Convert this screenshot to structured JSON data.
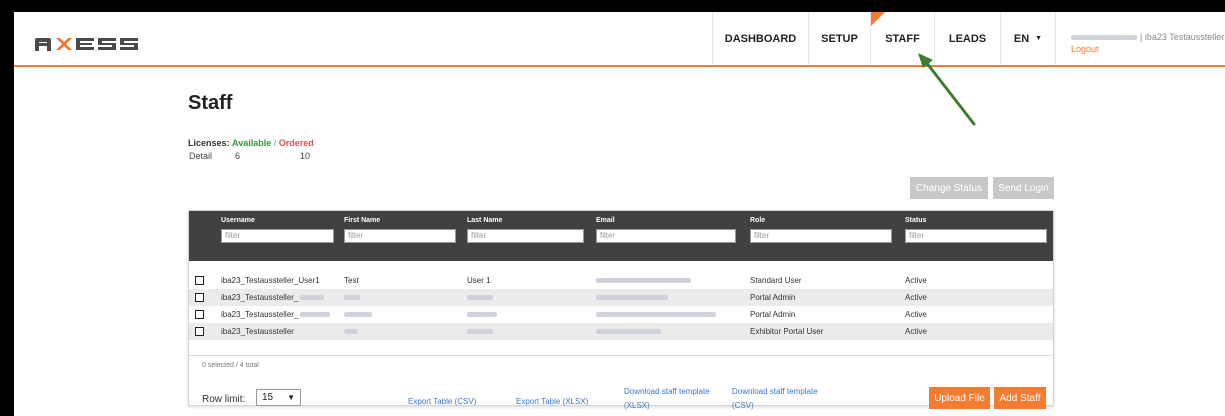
{
  "header": {
    "nav": [
      {
        "label": "DASHBOARD"
      },
      {
        "label": "SETUP"
      },
      {
        "label": "STAFF"
      },
      {
        "label": "LEADS"
      }
    ],
    "lang": "EN",
    "user_suffix": "| iba23 Testaussteller",
    "logout": "Logout"
  },
  "page": {
    "title": "Staff",
    "licenses_label": "Licenses:",
    "available_label": "Available",
    "sep": "/",
    "ordered_label": "Ordered",
    "detail_label": "Detail",
    "available_count": "6",
    "ordered_count": "10"
  },
  "actions": {
    "change_status": "Change Status",
    "send_login": "Send Login"
  },
  "table": {
    "columns": [
      "Username",
      "First Name",
      "Last Name",
      "Email",
      "Role",
      "Status"
    ],
    "filter_placeholder": "filter",
    "rows": [
      {
        "username": "iba23_Testaussteller_User1",
        "first": "Test",
        "last": "User 1",
        "role": "Standard User",
        "status": "Active"
      },
      {
        "username": "iba23_Testaussteller_",
        "first": "",
        "last": "",
        "role": "Portal Admin",
        "status": "Active"
      },
      {
        "username": "iba23_Testaussteller_",
        "first": "",
        "last": "",
        "role": "Portal Admin",
        "status": "Active"
      },
      {
        "username": "iba23_Testaussteller",
        "first": "",
        "last": "",
        "role": "Exhibitor Portal User",
        "status": "Active"
      }
    ],
    "selection_summary": "0 selected / 4 total"
  },
  "footer": {
    "row_limit_label": "Row limit:",
    "row_limit_value": "15",
    "export_csv": "Export Table (CSV)",
    "export_xlsx": "Export Table (XLSX)",
    "download_xlsx_1": "Download staff template",
    "download_xlsx_2": "(XLSX)",
    "download_csv_1": "Download staff template",
    "download_csv_2": "(CSV)",
    "upload": "Upload File",
    "add_staff": "Add Staff"
  },
  "colors": {
    "accent": "#f47c30",
    "table_header": "#414141",
    "available": "#2e9a3a",
    "ordered": "#d9534f",
    "link": "#3a79c6",
    "arrow": "#3f7d2a"
  },
  "icons": {
    "lang_caret": "chevron-down-icon",
    "row_limit_caret": "chevron-down-icon",
    "annotation": "arrow-icon"
  }
}
